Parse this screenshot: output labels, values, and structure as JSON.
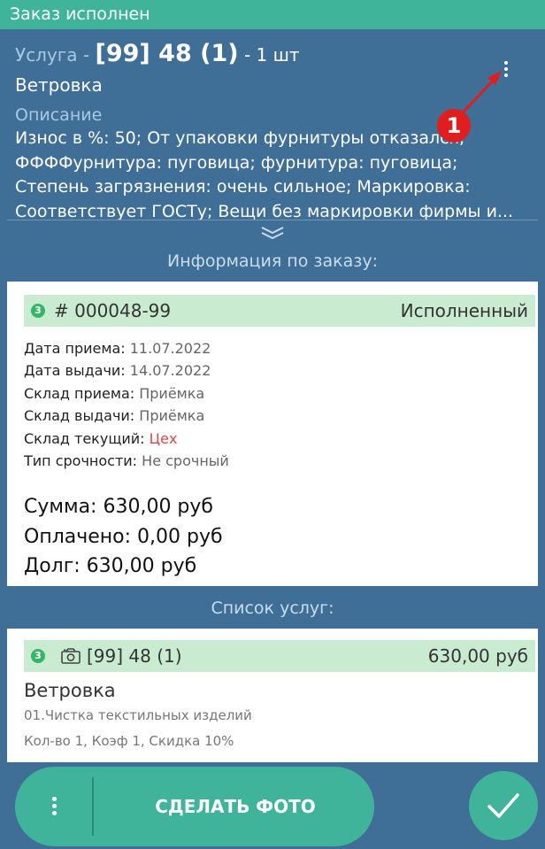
{
  "status_bar": {
    "title": "Заказ исполнен"
  },
  "header": {
    "service_prefix": "Услуга - ",
    "service_code": "[99] 48 (1)",
    "service_qty": " - 1 шт",
    "service_name": "Ветровка",
    "description_title": "Описание",
    "description_text": "Износ в %: 50; От упаковки фурнитуры отказался; ФФФФурнитура: пуговица; фурнитура: пуговица; Степень загрязнения: очень сильное; Маркировка: Соответствует ГОСТу; Вещи без маркировки фирмы и..."
  },
  "annotation": {
    "badge": "1",
    "color": "#e01e1e"
  },
  "order_section": {
    "title": "Информация по заказу:"
  },
  "order": {
    "badge": "3",
    "number": "# 000048-99",
    "status": "Исполненный",
    "info": [
      {
        "label": "Дата приема:",
        "value": "11.07.2022"
      },
      {
        "label": "Дата выдачи:",
        "value": "14.07.2022"
      },
      {
        "label": "Склад приема:",
        "value": "Приёмка"
      },
      {
        "label": "Склад выдачи:",
        "value": "Приёмка"
      },
      {
        "label": "Склад текущий:",
        "value": "Цех"
      },
      {
        "label": "Тип срочности:",
        "value": "Не срочный"
      }
    ],
    "sum": "Сумма: 630,00 руб",
    "paid": "Оплачено: 0,00 руб",
    "debt": "Долг: 630,00 руб"
  },
  "services_section": {
    "title": "Список услуг:"
  },
  "service_item": {
    "badge": "3",
    "icon": "camera-icon",
    "code": "[99] 48 (1)",
    "price": "630,00 руб",
    "name": "Ветровка",
    "category": "01.Чистка текстильных изделий",
    "params": "Кол-во 1, Коэф 1, Скидка 10%"
  },
  "bottom_bar": {
    "photo_label": "СДЕЛАТЬ ФОТО",
    "confirm_icon": "check-icon"
  },
  "colors": {
    "accent_green": "#3fb49b",
    "primary_blue": "#3f6e96",
    "row_green": "#c9ecd0",
    "badge_green": "#35b56a",
    "warning_red": "#e04545"
  }
}
